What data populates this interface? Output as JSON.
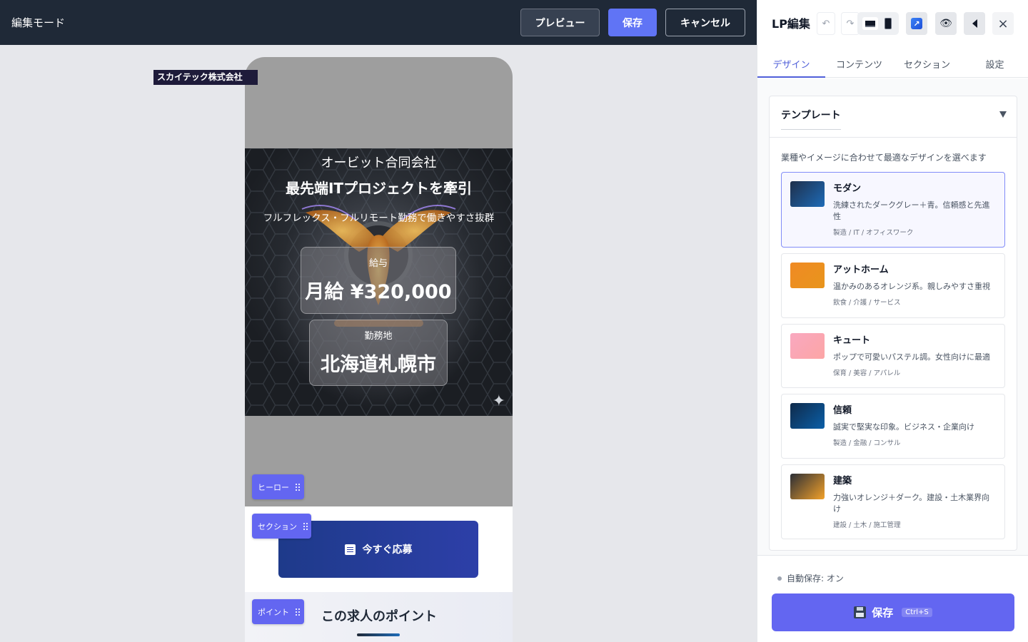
{
  "topbar": {
    "mode_label": "編集モード",
    "preview_label": "プレビュー",
    "save_label": "保存",
    "cancel_label": "キャンセル"
  },
  "canvas": {
    "company_tag": "スカイテック株式会社",
    "hero": {
      "company": "オービット合同会社",
      "title": "最先端ITプロジェクトを牽引",
      "subtitle": "フルフレックス・フルリモート勤務で働きやすさ抜群",
      "salary_label": "給与",
      "salary_value": "月給 ¥320,000",
      "location_label": "勤務地",
      "location_value": "北海道札幌市"
    },
    "apply_label": "今すぐ応募",
    "points_title": "この求人のポイント",
    "chips": {
      "hero": "ヒーロー",
      "section": "セクション",
      "point": "ポイント"
    }
  },
  "panel": {
    "title": "LP編集",
    "tabs": [
      {
        "label": "デザイン",
        "active": true
      },
      {
        "label": "コンテンツ",
        "active": false
      },
      {
        "label": "セクション",
        "active": false
      },
      {
        "label": "設定",
        "active": false
      }
    ],
    "template_section": {
      "heading": "テンプレート",
      "description": "業種やイメージに合わせて最適なデザインを選べます",
      "items": [
        {
          "name": "モダン",
          "description": "洗練されたダークグレー＋青。信頼感と先進性",
          "tags": "製造 / IT / オフィスワーク",
          "selected": true
        },
        {
          "name": "アットホーム",
          "description": "温かみのあるオレンジ系。親しみやすさ重視",
          "tags": "飲食 / 介護 / サービス",
          "selected": false
        },
        {
          "name": "キュート",
          "description": "ポップで可愛いパステル調。女性向けに最適",
          "tags": "保育 / 美容 / アパレル",
          "selected": false
        },
        {
          "name": "信頼",
          "description": "誠実で堅実な印象。ビジネス・企業向け",
          "tags": "製造 / 金融 / コンサル",
          "selected": false
        },
        {
          "name": "建築",
          "description": "力強いオレンジ＋ダーク。建設・土木業界向け",
          "tags": "建設 / 土木 / 施工管理",
          "selected": false
        }
      ]
    },
    "autosave_label": "自動保存: オン",
    "save_label": "保存",
    "save_shortcut": "Ctrl+S"
  },
  "colors": {
    "accent": "#6366f1",
    "topbar_bg": "#1f2937",
    "apply_button": "#1e3a8a",
    "swatch_modern": [
      "#1f2f4a",
      "#1e6bb8"
    ],
    "swatch_athome": [
      "#f08a24",
      "#e8951c"
    ],
    "swatch_cute": [
      "#f9a8c0",
      "#fca5a5"
    ],
    "swatch_trust": [
      "#0f2a4a",
      "#0b5fa8"
    ],
    "swatch_build": [
      "#2b2e36",
      "#f2a12a"
    ]
  },
  "icons": {
    "undo": "undo-icon",
    "redo": "redo-icon",
    "desktop": "monitor-icon",
    "mobile": "mobile-icon",
    "open_external": "external-link-icon",
    "preview": "eye-icon",
    "collapse": "collapse-left-icon",
    "close": "close-icon",
    "apply": "document-icon",
    "save": "floppy-disk-icon"
  }
}
